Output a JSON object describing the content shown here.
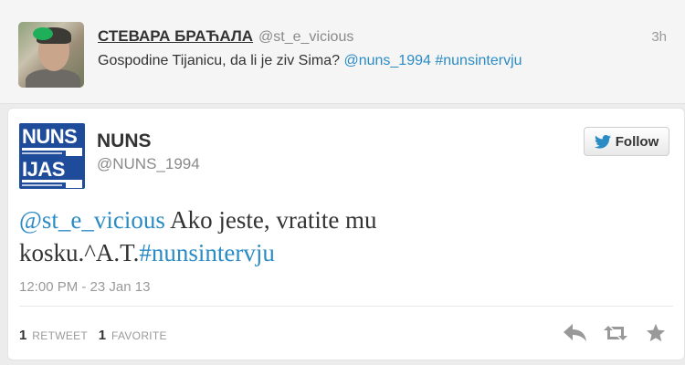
{
  "reply": {
    "author_name": "СТЕВАРА БРАЋАЛА",
    "author_handle": "@st_e_vicious",
    "time": "3h",
    "text_plain": "Gospodine Tijanicu, da li je ziv Sima? ",
    "mention": "@nuns_1994",
    "hashtag": "#nunsintervju"
  },
  "main_tweet": {
    "author_name": "NUNS",
    "author_handle": "@NUNS_1994",
    "follow_label": "Follow",
    "mention": "@st_e_vicious",
    "text": " Ako jeste, vratite mu kosku.^A.T.",
    "hashtag": "#nunsintervju",
    "date": "12:00 PM - 23 Jan 13",
    "retweet_count": "1",
    "retweet_label": "RETWEET",
    "favorite_count": "1",
    "favorite_label": "FAVORITE"
  },
  "logo": {
    "top_text": "NUNS",
    "bottom_text": "IJAS"
  },
  "icons": {
    "follow": "twitter-bird-icon",
    "reply": "reply-icon",
    "retweet": "retweet-icon",
    "favorite": "star-icon"
  },
  "colors": {
    "link": "#2b8bc4",
    "logo_blue": "#1f4c9a"
  }
}
